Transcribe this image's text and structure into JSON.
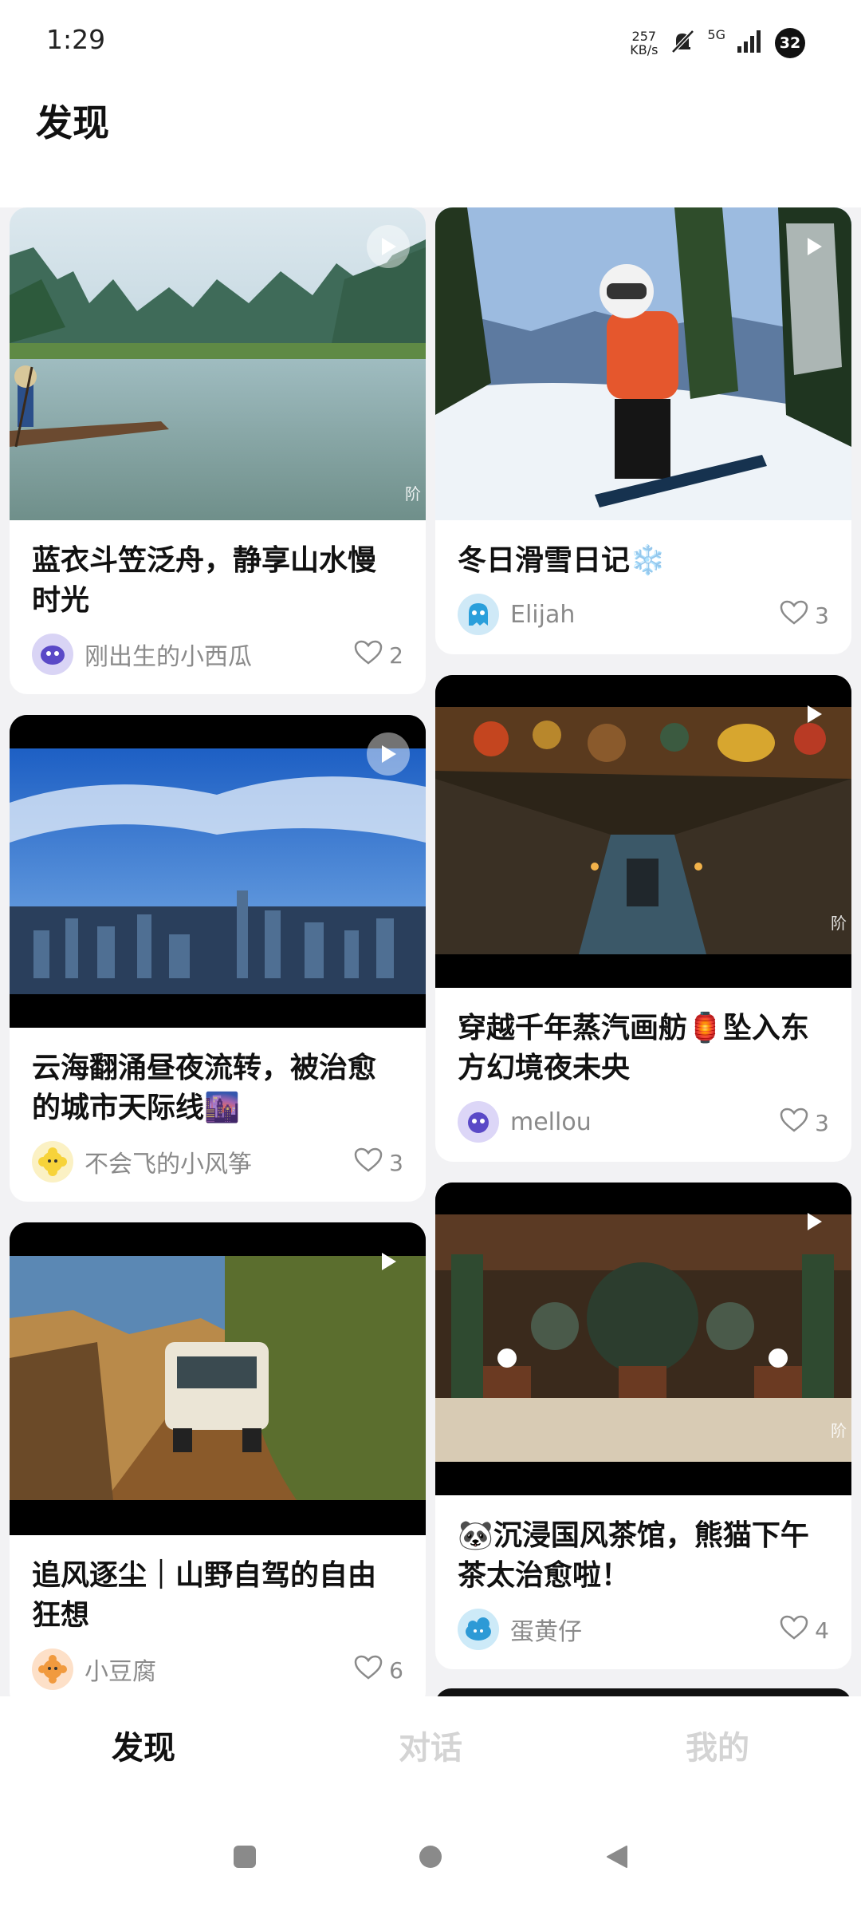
{
  "status": {
    "time": "1:29",
    "net_speed_value": "257",
    "net_speed_unit": "KB/s",
    "network": "5G",
    "battery": "32"
  },
  "header": {
    "title": "发现"
  },
  "feed": {
    "cards": [
      {
        "title": "蓝衣斗笠泛舟，静享山水慢时光",
        "author": "刚出生的小西瓜",
        "likes": "2",
        "corner": "阶"
      },
      {
        "title": "冬日滑雪日记❄️",
        "author": "Elijah",
        "likes": "3"
      },
      {
        "title": "云海翻涌昼夜流转，被治愈的城市天际线🌆",
        "author": "不会飞的小风筝",
        "likes": "3"
      },
      {
        "title": "穿越千年蒸汽画舫🏮坠入东方幻境夜未央",
        "author": "mellou",
        "likes": "3",
        "corner": "阶"
      },
      {
        "title": "追风逐尘｜山野自驾的自由狂想",
        "author": "小豆腐",
        "likes": "6"
      },
      {
        "title": "🐼沉浸国风茶馆，熊猫下午茶太治愈啦！",
        "author": "蛋黄仔",
        "likes": "4",
        "corner": "阶"
      }
    ]
  },
  "tabbar": {
    "tabs": [
      {
        "label": "发现",
        "active": true
      },
      {
        "label": "对话",
        "active": false
      },
      {
        "label": "我的",
        "active": false
      }
    ]
  },
  "icons": {
    "play": "play-icon",
    "heart": "heart-icon",
    "mute": "bell-muted-icon",
    "signal": "signal-icon"
  },
  "colors": {
    "background": "#f2f2f4",
    "card": "#ffffff",
    "text_primary": "#111111",
    "text_secondary": "#8a8a8a",
    "tab_inactive": "#d4d4d4"
  }
}
